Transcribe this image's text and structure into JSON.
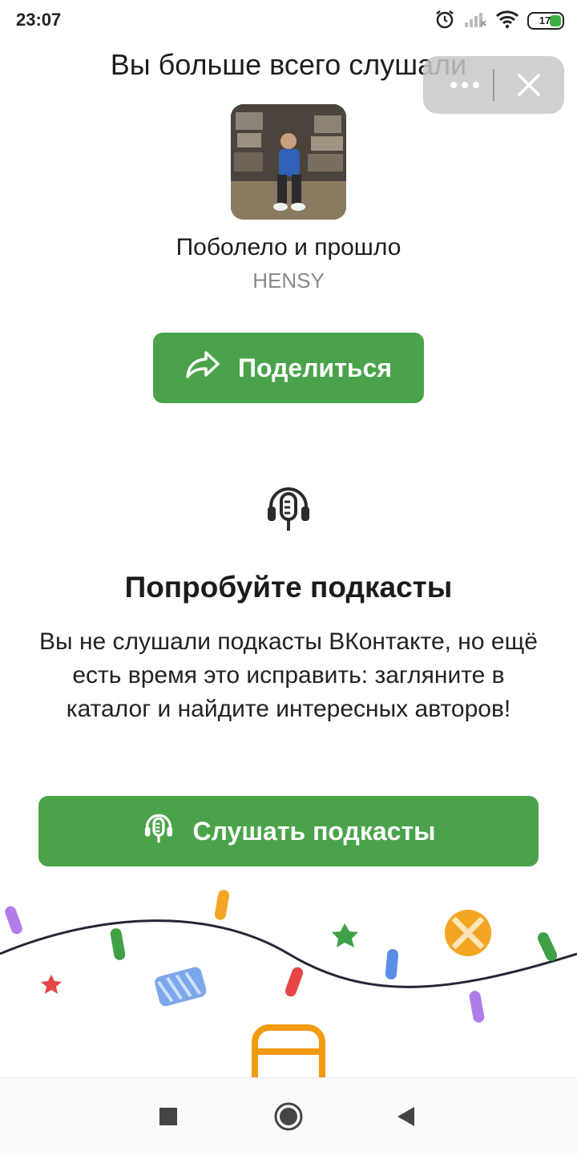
{
  "status_bar": {
    "time": "23:07",
    "battery_level": "17",
    "icons": [
      "alarm-icon",
      "signal-off-icon",
      "wifi-icon",
      "battery-icon"
    ]
  },
  "top_title": "Вы больше всего слушали",
  "overlay": {
    "icons": [
      "more-icon",
      "close-icon"
    ]
  },
  "track": {
    "title": "Поболело и прошло",
    "artist": "HENSY"
  },
  "share_button": {
    "label": "Поделиться",
    "icon": "share-icon"
  },
  "podcasts": {
    "heading": "Попробуйте подкасты",
    "text": "Вы не слушали подкасты ВКонтакте, но ещё есть время это исправить: загляните в каталог и найдите интересных авторов!",
    "button_label": "Слушать подкасты",
    "icon": "podcast-icon"
  },
  "nav_bar": {
    "icons": [
      "recents-icon",
      "home-icon",
      "back-icon"
    ]
  },
  "colors": {
    "accent_green": "#4aa34a",
    "muted_text": "#858a90"
  }
}
